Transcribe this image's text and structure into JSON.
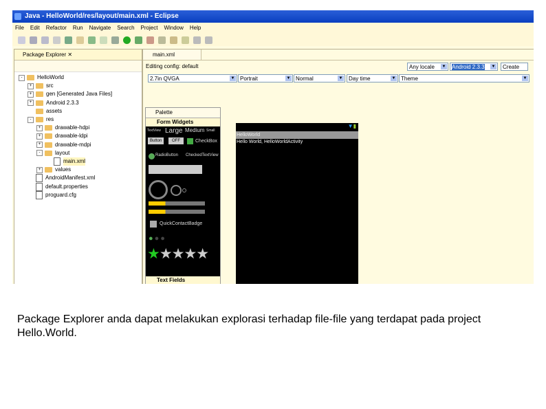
{
  "window": {
    "title": "Java - HelloWorld/res/layout/main.xml - Eclipse"
  },
  "menu": [
    "File",
    "Edit",
    "Refactor",
    "Run",
    "Navigate",
    "Search",
    "Project",
    "Window",
    "Help"
  ],
  "package_explorer": {
    "tab": "Package Explorer",
    "tree": [
      {
        "label": "HelloWorld",
        "level": 0,
        "exp": "-"
      },
      {
        "label": "src",
        "level": 1,
        "exp": "+"
      },
      {
        "label": "gen [Generated Java Files]",
        "level": 1,
        "exp": "+"
      },
      {
        "label": "Android 2.3.3",
        "level": 1,
        "exp": "+"
      },
      {
        "label": "assets",
        "level": 1,
        "exp": ""
      },
      {
        "label": "res",
        "level": 1,
        "exp": "-"
      },
      {
        "label": "drawable-hdpi",
        "level": 2,
        "exp": "+"
      },
      {
        "label": "drawable-ldpi",
        "level": 2,
        "exp": "+"
      },
      {
        "label": "drawable-mdpi",
        "level": 2,
        "exp": "+"
      },
      {
        "label": "layout",
        "level": 2,
        "exp": "-"
      },
      {
        "label": "main.xml",
        "level": 3,
        "exp": ""
      },
      {
        "label": "values",
        "level": 2,
        "exp": "+"
      },
      {
        "label": "AndroidManifest.xml",
        "level": 1,
        "exp": ""
      },
      {
        "label": "default.properties",
        "level": 1,
        "exp": ""
      },
      {
        "label": "proguard.cfg",
        "level": 1,
        "exp": ""
      }
    ]
  },
  "editor": {
    "tab": "main.xml",
    "editing_config": "Editing config: default",
    "locale": "Any locale",
    "target": "Android 2.3.3",
    "create": "Create",
    "screen": "2.7in QVGA",
    "orientation": "Portrait",
    "dock": "Normal",
    "time": "Day time",
    "theme": "Theme"
  },
  "palette": {
    "title": "Palette",
    "section": "Form Widgets",
    "section2": "Text Fields",
    "textviews": [
      "TextView",
      "Large",
      "Medium",
      "Small"
    ],
    "button": "Button",
    "toggle": "OFF",
    "checkbox": "CheckBox",
    "radio": "RadioButton",
    "checked_text": "CheckedTextView",
    "badge": "QuickContactBadge"
  },
  "device": {
    "app_title": "HelloWorld",
    "text": "Hello World, HelloWorldActivity"
  },
  "caption": "Package Explorer anda dapat melakukan explorasi terhadap file-file yang terdapat pada project Hello.World."
}
